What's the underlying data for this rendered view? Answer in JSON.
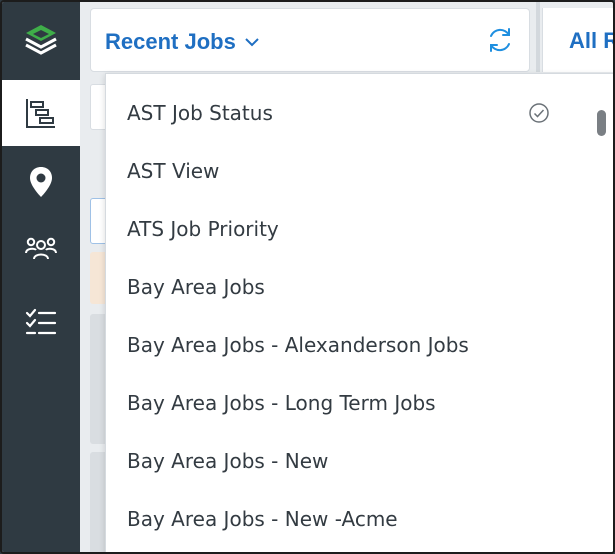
{
  "header": {
    "title": "Recent Jobs",
    "secondary_tab": "All R"
  },
  "sidebar": {
    "items": [
      {
        "icon": "layers-logo-icon"
      },
      {
        "icon": "gantt-icon",
        "active": true
      },
      {
        "icon": "map-pin-icon"
      },
      {
        "icon": "users-icon"
      },
      {
        "icon": "checklist-icon"
      }
    ]
  },
  "dropdown": {
    "items": [
      {
        "label": "AST Job Status",
        "selected": true
      },
      {
        "label": "AST View"
      },
      {
        "label": "ATS Job Priority"
      },
      {
        "label": "Bay Area Jobs"
      },
      {
        "label": "Bay Area Jobs - Alexanderson Jobs"
      },
      {
        "label": "Bay Area Jobs - Long Term Jobs"
      },
      {
        "label": "Bay Area Jobs - New"
      },
      {
        "label": "Bay Area Jobs - New -Acme"
      }
    ]
  },
  "colors": {
    "accent": "#1f6fc2",
    "sidebar": "#2f3a42",
    "logo_green": "#3fae49"
  }
}
